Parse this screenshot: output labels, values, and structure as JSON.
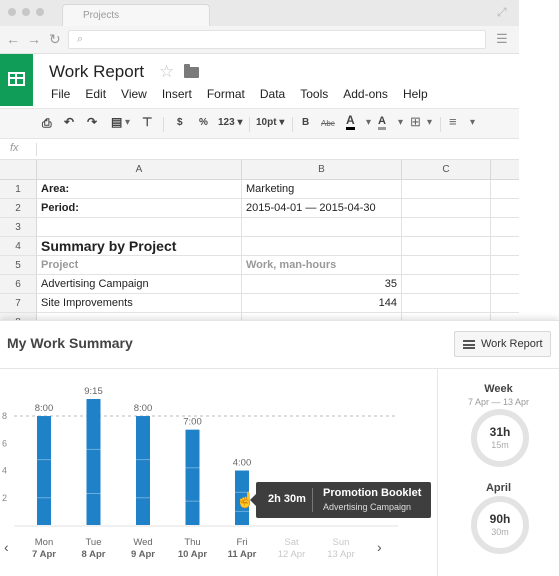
{
  "browser": {
    "tab_title": "Projects"
  },
  "sheet": {
    "doc_title": "Work Report",
    "menu": [
      "File",
      "Edit",
      "View",
      "Insert",
      "Format",
      "Data",
      "Tools",
      "Add-ons",
      "Help"
    ],
    "toolbar": {
      "currency": "$",
      "percent": "%",
      "number_format": "123 ▾",
      "font_size": "10pt ▾",
      "bold": "B",
      "strikethrough": "Abc",
      "text_color": "A",
      "fill_color": "A"
    },
    "formula_label": "fx",
    "columns": [
      "A",
      "B",
      "C"
    ],
    "rows": [
      {
        "n": "1",
        "a": "Area:",
        "b": "Marketing",
        "b_num": false,
        "style": "bold"
      },
      {
        "n": "2",
        "a": "Period:",
        "b": "2015-04-01 — 2015-04-30",
        "b_num": false,
        "style": "bold"
      },
      {
        "n": "3",
        "a": "",
        "b": "",
        "b_num": false,
        "style": ""
      },
      {
        "n": "4",
        "a": "Summary by Project",
        "b": "",
        "b_num": false,
        "style": "big"
      },
      {
        "n": "5",
        "a": "Project",
        "b": "Work, man-hours",
        "b_num": false,
        "style": "gray"
      },
      {
        "n": "6",
        "a": "Advertising Campaign",
        "b": "35",
        "b_num": true,
        "style": ""
      },
      {
        "n": "7",
        "a": "Site Improvements",
        "b": "144",
        "b_num": true,
        "style": ""
      },
      {
        "n": "8",
        "a": "",
        "b": "",
        "b_num": false,
        "style": ""
      }
    ]
  },
  "panel": {
    "title": "My Work Summary",
    "report_button": "Work Report",
    "tooltip": {
      "duration": "2h 30m",
      "project": "Promotion Booklet",
      "subproject": "Advertising Campaign"
    },
    "week": {
      "label": "Week",
      "range": "7 Apr — 13 Apr",
      "hours": "31h",
      "minutes": "15m"
    },
    "month": {
      "label": "April",
      "hours": "90h",
      "minutes": "30m"
    }
  },
  "chart_data": {
    "type": "bar",
    "categories": [
      {
        "day": "Mon",
        "date": "7 Apr",
        "weekend": false
      },
      {
        "day": "Tue",
        "date": "8 Apr",
        "weekend": false
      },
      {
        "day": "Wed",
        "date": "9 Apr",
        "weekend": false
      },
      {
        "day": "Thu",
        "date": "10 Apr",
        "weekend": false
      },
      {
        "day": "Fri",
        "date": "11 Apr",
        "weekend": false
      },
      {
        "day": "Sat",
        "date": "12 Apr",
        "weekend": true
      },
      {
        "day": "Sun",
        "date": "13 Apr",
        "weekend": true
      }
    ],
    "values": [
      8,
      9.25,
      8,
      7,
      4,
      0,
      0
    ],
    "labels": [
      "8:00",
      "9:15",
      "8:00",
      "7:00",
      "4:00",
      "",
      ""
    ],
    "y_ticks": [
      "8",
      "6",
      "4",
      "2"
    ],
    "ylim": [
      0,
      9.25
    ],
    "target_line": 8,
    "bar_color": "#1f82c9"
  }
}
